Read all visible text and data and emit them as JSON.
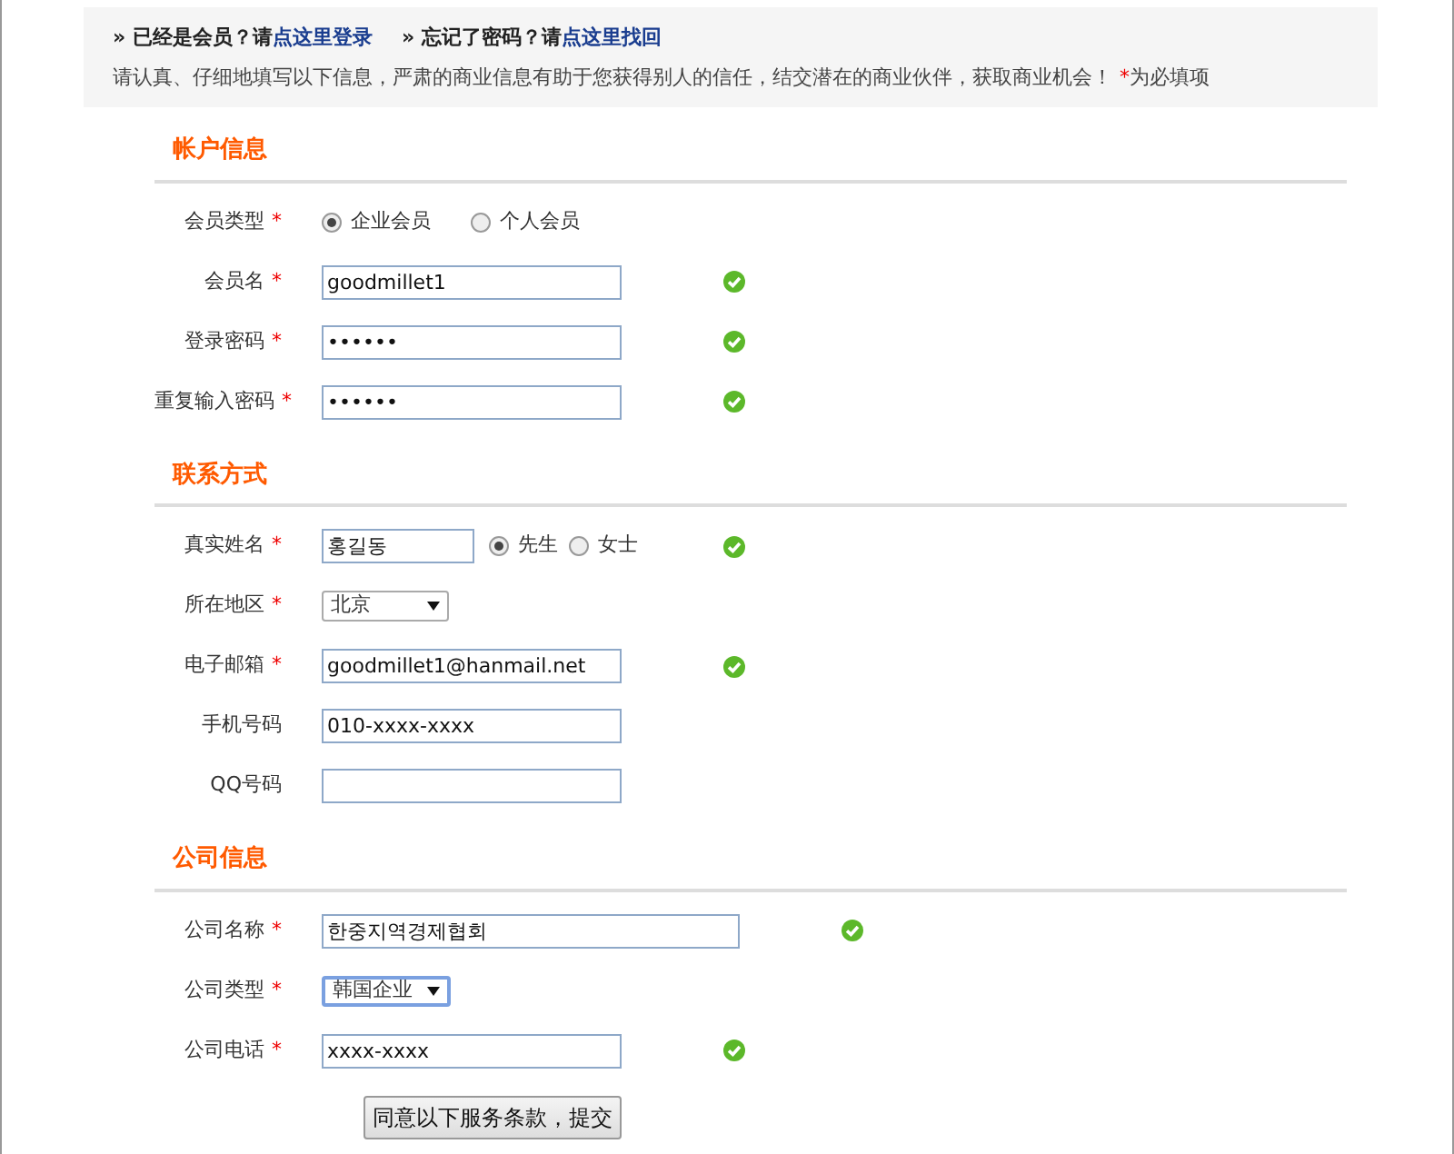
{
  "notice": {
    "links": [
      {
        "prompt": "» 已经是会员？请",
        "link": "点这里登录"
      },
      {
        "prompt": "» 忘记了密码？请",
        "link": "点这里找回"
      }
    ],
    "intro": "请认真、仔细地填写以下信息，严肃的商业信息有助于您获得别人的信任，结交潜在的商业伙伴，获取商业机会！",
    "required_mark": "*",
    "required_note": "为必填项"
  },
  "sections": [
    {
      "title": "帐户信息",
      "fields": [
        {
          "kind": "radio",
          "label": "会员类型",
          "required": true,
          "valid": false,
          "options": [
            {
              "label": "企业会员",
              "selected": true
            },
            {
              "label": "个人会员",
              "selected": false
            }
          ]
        },
        {
          "kind": "text",
          "label": "会员名",
          "required": true,
          "valid": true,
          "value": "goodmillet1"
        },
        {
          "kind": "text",
          "label": "登录密码",
          "required": true,
          "valid": true,
          "value": "••••••"
        },
        {
          "kind": "text",
          "label": "重复输入密码",
          "required": true,
          "valid": true,
          "value": "••••••"
        }
      ]
    },
    {
      "title": "联系方式",
      "fields": [
        {
          "kind": "name",
          "label": "真实姓名",
          "required": true,
          "valid": true,
          "value": "홍길동",
          "options": [
            {
              "label": "先生",
              "selected": true
            },
            {
              "label": "女士",
              "selected": false
            }
          ]
        },
        {
          "kind": "select",
          "label": "所在地区",
          "required": true,
          "valid": false,
          "value": "北京"
        },
        {
          "kind": "text",
          "label": "电子邮箱",
          "required": true,
          "valid": true,
          "value": "goodmillet1@hanmail.net"
        },
        {
          "kind": "text",
          "label": "手机号码",
          "required": false,
          "valid": false,
          "value": "010-xxxx-xxxx"
        },
        {
          "kind": "text",
          "label": "QQ号码",
          "required": false,
          "valid": false
        }
      ]
    },
    {
      "title": "公司信息",
      "fields": [
        {
          "kind": "wide",
          "label": "公司名称",
          "required": true,
          "valid": true,
          "value": "한중지역경제협회"
        },
        {
          "kind": "select",
          "label": "公司类型",
          "required": true,
          "valid": false,
          "value": "韩国企业"
        },
        {
          "kind": "text",
          "label": "公司电话",
          "required": true,
          "valid": true,
          "value": "xxxx-xxxx"
        }
      ]
    }
  ],
  "submit": "同意以下服务条款，提交"
}
